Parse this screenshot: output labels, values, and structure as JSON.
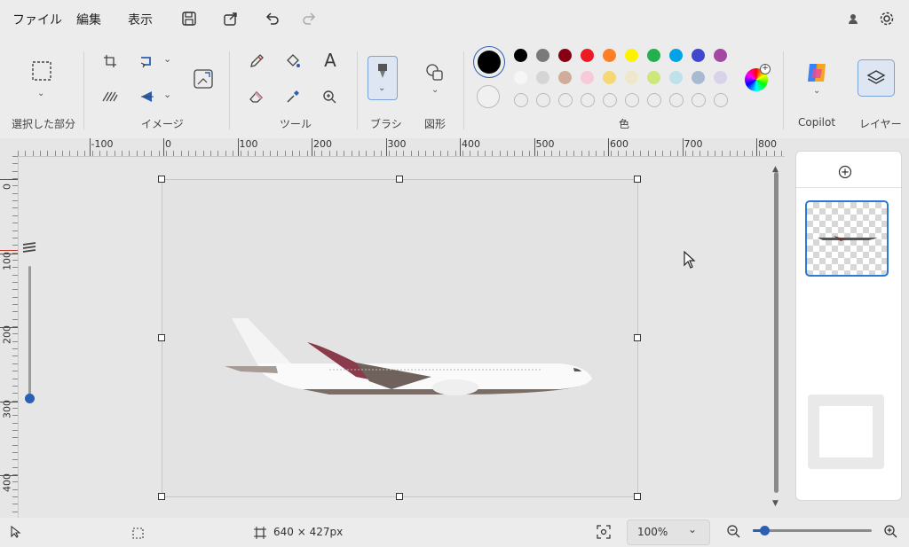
{
  "menu": {
    "file": "ファイル",
    "edit": "編集",
    "view": "表示"
  },
  "ribbon": {
    "groups": {
      "selection": "選択した部分",
      "image": "イメージ",
      "tools": "ツール",
      "brushes": "ブラシ",
      "shapes": "図形",
      "colors": "色",
      "copilot": "Copilot",
      "layers": "レイヤー"
    },
    "text_tool_glyph": "A",
    "palette_row1": [
      "#000000",
      "#7a7a7a",
      "#880015",
      "#ed1c24",
      "#ff7f27",
      "#fff200",
      "#22b14c",
      "#00a2e8",
      "#3f48cc",
      "#a349a4"
    ],
    "palette_row2": [
      "#ffffff",
      "#c3c3c3",
      "#b97a57",
      "#ffaec9",
      "#ffc90e",
      "#efe4b0",
      "#b5e61d",
      "#99d9ea",
      "#7092be",
      "#c8bfe7"
    ],
    "primary_color": "#000000",
    "secondary_color": "#ffffff"
  },
  "ruler": {
    "h_labels": [
      "-100",
      "0",
      "100",
      "200",
      "300",
      "400",
      "500",
      "600",
      "700",
      "800"
    ],
    "v_labels": [
      "0",
      "100",
      "200",
      "300",
      "400"
    ]
  },
  "status": {
    "size_text": "640 × 427px",
    "zoom_value": "100%",
    "zoom_level": 0.1
  }
}
